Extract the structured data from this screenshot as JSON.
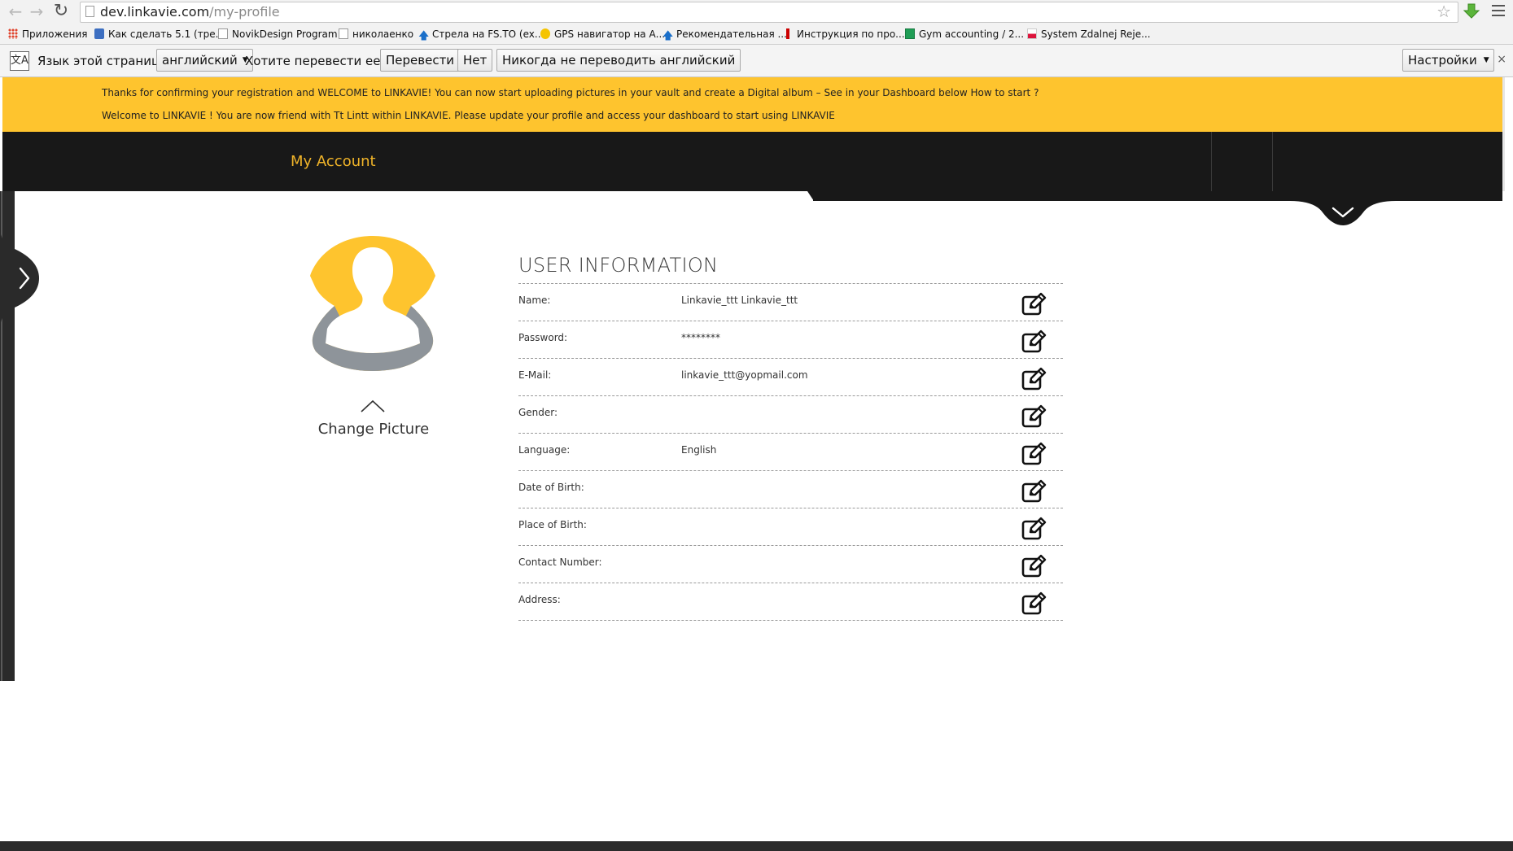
{
  "browser": {
    "url_domain": "dev.linkavie.com",
    "url_path": "/my-profile",
    "bookmarks": [
      "Приложения",
      "Как сделать 5.1 (тре...",
      "NovikDesign Program",
      "николаенко",
      "Стрела на FS.TO (ex...",
      "GPS навигатор на А...",
      "Рекомендательная ...",
      "Инструкция по про...",
      "Gym accounting / 2...",
      "System Zdalnej Reje..."
    ]
  },
  "translate_bar": {
    "page_language_label": "Язык этой страницы",
    "language_selected": "английский",
    "question": "Хотите перевести ее?",
    "translate_button": "Перевести",
    "no_button": "Нет",
    "never_button": "Никогда не переводить английский",
    "settings_button": "Настройки",
    "close": "×"
  },
  "notice": {
    "line1": "Thanks for confirming your registration and WELCOME to LINKAVIE! You can now start uploading pictures in your vault and create a Digital album – See in your Dashboard below How to start ?",
    "line2": "Welcome to LINKAVIE ! You are now friend with Tt Lintt within LINKAVIE. Please update your profile and access your dashboard to start using LINKAVIE"
  },
  "header": {
    "title": "My Account"
  },
  "profile": {
    "change_picture": "Change Picture"
  },
  "user_info": {
    "title": "USER INFORMATION",
    "rows": [
      {
        "label": "Name:",
        "value": "Linkavie_ttt Linkavie_ttt"
      },
      {
        "label": "Password:",
        "value": "********"
      },
      {
        "label": "E-Mail:",
        "value": "linkavie_ttt@yopmail.com"
      },
      {
        "label": "Gender:",
        "value": ""
      },
      {
        "label": "Language:",
        "value": "English"
      },
      {
        "label": "Date of Birth:",
        "value": ""
      },
      {
        "label": "Place of Birth:",
        "value": ""
      },
      {
        "label": "Contact Number:",
        "value": ""
      },
      {
        "label": "Address:",
        "value": ""
      }
    ]
  },
  "colors": {
    "accent": "#fec42e",
    "header_bg": "#181818",
    "header_title": "#f0b429",
    "avatar_gray": "#8e949a"
  }
}
